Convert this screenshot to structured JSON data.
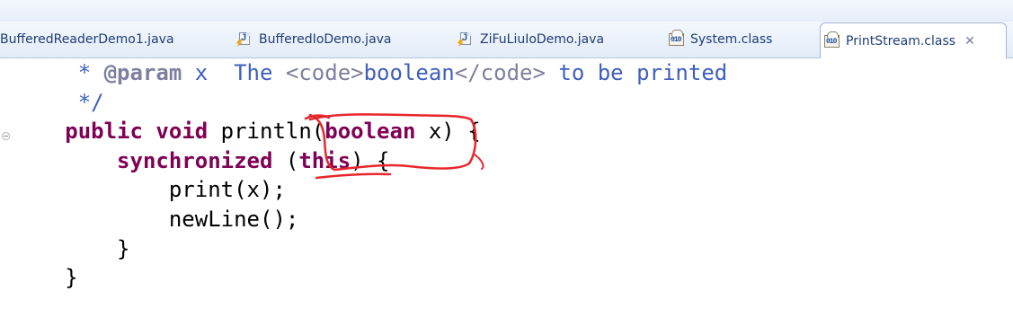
{
  "tabs": [
    {
      "label": "BufferedReaderDemo1.java",
      "icon": "java-file-icon",
      "active": false
    },
    {
      "label": "BufferedIoDemo.java",
      "icon": "java-file-icon",
      "active": false
    },
    {
      "label": "ZiFuLiuIoDemo.java",
      "icon": "java-file-icon",
      "active": false
    },
    {
      "label": "System.class",
      "icon": "class-file-icon",
      "active": false
    },
    {
      "label": "PrintStream.class",
      "icon": "class-file-icon",
      "active": true,
      "close": "✕"
    }
  ],
  "code": {
    "l1_star": "* ",
    "l1_tag": "@param",
    "l1_name": " x  ",
    "l1_the": "The ",
    "l1_code_open": "<code>",
    "l1_bool": "boolean",
    "l1_code_close": "</code>",
    "l1_rest": " to be printed",
    "l2": "*/",
    "l3_public": "public",
    "l3_void": "void",
    "l3_sig": " println(",
    "l3_boolean": "boolean",
    "l3_end": " x) {",
    "l4_sync": "synchronized",
    "l4_paren": " (",
    "l4_this": "this",
    "l4_end": ") {",
    "l5": "print(x);",
    "l6": "newLine();",
    "l7": "}",
    "l8": "}"
  },
  "colors": {
    "keyword": "#7f0055",
    "javadoc": "#3f5fbf",
    "javadoc_tag": "#7f7f9f",
    "annotation": "#e8262b"
  }
}
